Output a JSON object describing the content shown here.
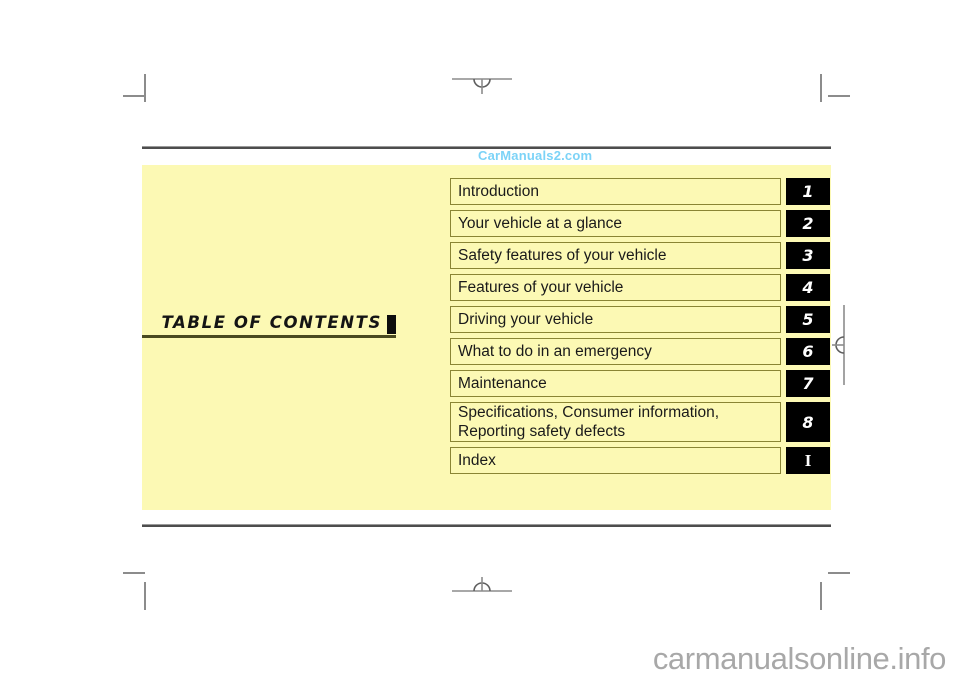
{
  "page": {
    "heading": "TABLE OF CONTENTS",
    "watermark_top": "CarManuals2.com",
    "watermark_bottom": "carmanualsonline.info",
    "background_color": "#ffffff",
    "panel_color": "#fcf9b4",
    "accent_color": "#7cd3f7",
    "box_border_color": "#8a8534",
    "tab_color": "#000000"
  },
  "toc": {
    "items": [
      {
        "label": "Introduction",
        "number": "1"
      },
      {
        "label": "Your vehicle at a glance",
        "number": "2"
      },
      {
        "label": "Safety features of your vehicle",
        "number": "3"
      },
      {
        "label": "Features of your vehicle",
        "number": "4"
      },
      {
        "label": "Driving your vehicle",
        "number": "5"
      },
      {
        "label": "What to do in an emergency",
        "number": "6"
      },
      {
        "label": "Maintenance",
        "number": "7"
      },
      {
        "label": "Specifications, Consumer information,\nReporting safety defects",
        "number": "8"
      },
      {
        "label": "Index",
        "number": "I"
      }
    ]
  }
}
